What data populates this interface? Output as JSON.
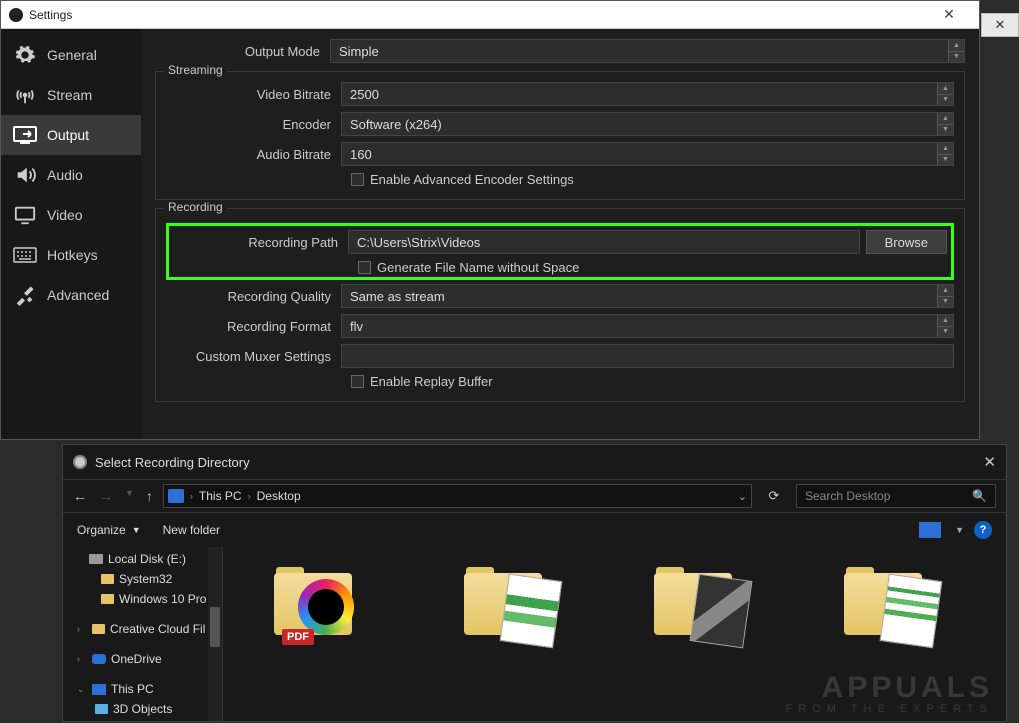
{
  "settings": {
    "title": "Settings",
    "sidebar": [
      {
        "id": "general",
        "label": "General"
      },
      {
        "id": "stream",
        "label": "Stream"
      },
      {
        "id": "output",
        "label": "Output"
      },
      {
        "id": "audio",
        "label": "Audio"
      },
      {
        "id": "video",
        "label": "Video"
      },
      {
        "id": "hotkeys",
        "label": "Hotkeys"
      },
      {
        "id": "advanced",
        "label": "Advanced"
      }
    ],
    "active_sidebar": "output",
    "output_mode": {
      "label": "Output Mode",
      "value": "Simple"
    },
    "streaming": {
      "legend": "Streaming",
      "video_bitrate": {
        "label": "Video Bitrate",
        "value": "2500"
      },
      "encoder": {
        "label": "Encoder",
        "value": "Software (x264)"
      },
      "audio_bitrate": {
        "label": "Audio Bitrate",
        "value": "160"
      },
      "adv_checkbox": "Enable Advanced Encoder Settings"
    },
    "recording": {
      "legend": "Recording",
      "path": {
        "label": "Recording Path",
        "value": "C:\\Users\\Strix\\Videos",
        "browse": "Browse"
      },
      "gen_filename": "Generate File Name without Space",
      "quality": {
        "label": "Recording Quality",
        "value": "Same as stream"
      },
      "format": {
        "label": "Recording Format",
        "value": "flv"
      },
      "muxer": {
        "label": "Custom Muxer Settings",
        "value": ""
      },
      "replay": "Enable Replay Buffer"
    }
  },
  "picker": {
    "title": "Select Recording Directory",
    "breadcrumb": {
      "root": "This PC",
      "leaf": "Desktop"
    },
    "search_placeholder": "Search Desktop",
    "organize": "Organize",
    "newfolder": "New folder",
    "tree": [
      {
        "kind": "disk",
        "label": "Local Disk (E:)"
      },
      {
        "kind": "folder",
        "label": "System32"
      },
      {
        "kind": "folder",
        "label": "Windows 10 Pro"
      },
      {
        "kind": "folder",
        "label": "Creative Cloud Fil",
        "chev": ">"
      },
      {
        "kind": "cloud",
        "label": "OneDrive",
        "chev": ">"
      },
      {
        "kind": "pc",
        "label": "This PC",
        "chev": "v"
      },
      {
        "kind": "folder",
        "label": "3D Objects"
      }
    ]
  },
  "watermark": {
    "line1": "APPUALS",
    "line2": "FROM THE EXPERTS"
  }
}
